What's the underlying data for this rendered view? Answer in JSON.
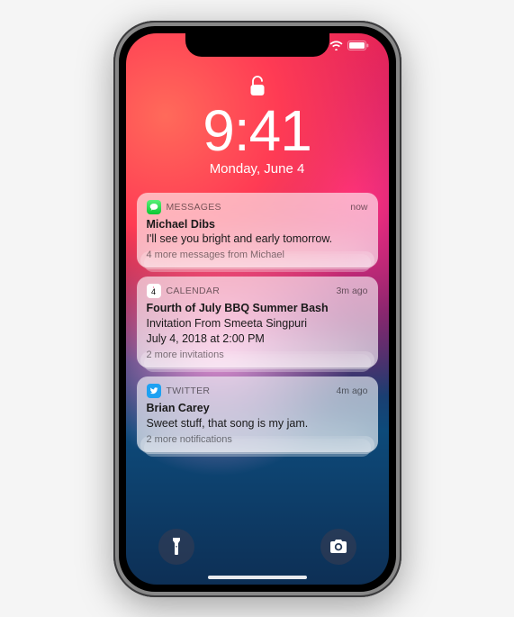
{
  "lockscreen": {
    "time": "9:41",
    "date": "Monday, June 4"
  },
  "notifications": [
    {
      "app": "MESSAGES",
      "icon": "messages",
      "timestamp": "now",
      "title": "Michael Dibs",
      "body": "I'll see you bright and early tomorrow.",
      "more": "4 more messages from Michael"
    },
    {
      "app": "CALENDAR",
      "icon": "calendar",
      "cal_day": "4",
      "timestamp": "3m ago",
      "title": "Fourth of July BBQ Summer Bash",
      "body": "Invitation From Smeeta Singpuri",
      "body2": "July 4, 2018 at 2:00 PM",
      "more": "2 more invitations"
    },
    {
      "app": "TWITTER",
      "icon": "twitter",
      "timestamp": "4m ago",
      "title": "Brian Carey",
      "body": "Sweet stuff, that song is my jam.",
      "more": "2 more notifications"
    }
  ]
}
